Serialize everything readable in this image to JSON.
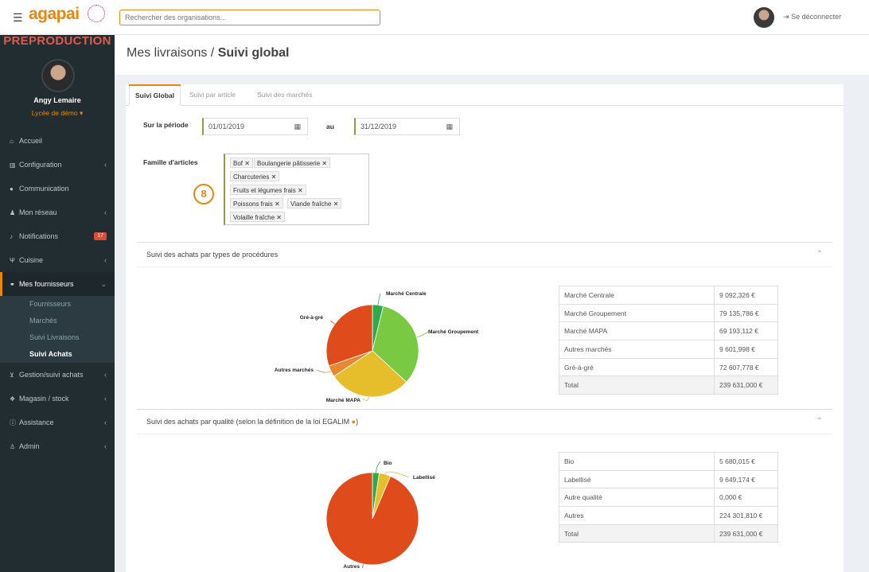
{
  "topbar": {
    "logo": "agapai",
    "search_placeholder": "Rechercher des organisations...",
    "logout": "Se déconnecter"
  },
  "sidebar": {
    "env_label": "PREPRODUCTION",
    "user_name": "Angy Lemaire",
    "user_school": "Lycée de démo ▾",
    "items": [
      {
        "label": "Accueil",
        "icon": "home-icon"
      },
      {
        "label": "Configuration",
        "icon": "bank-icon"
      },
      {
        "label": "Communication",
        "icon": "comments-icon"
      },
      {
        "label": "Mon réseau",
        "icon": "users-icon"
      },
      {
        "label": "Notifications",
        "icon": "bell-icon",
        "badge": "17"
      },
      {
        "label": "Cuisine",
        "icon": "cutlery-icon"
      },
      {
        "label": "Mes fournisseurs",
        "icon": "handshake-icon"
      },
      {
        "label": "Gestion/suivi achats",
        "icon": "cart-icon"
      },
      {
        "label": "Magasin / stock",
        "icon": "cubes-icon"
      },
      {
        "label": "Assistance",
        "icon": "info-icon"
      },
      {
        "label": "Admin",
        "icon": "user-plus-icon"
      }
    ],
    "subitems": [
      "Fournisseurs",
      "Marchés",
      "Suivi Livraisons",
      "Suivi Achats"
    ]
  },
  "header": {
    "title_prefix": "Mes livraisons / ",
    "title_bold": "Suivi global"
  },
  "tabs": [
    "Suivi Global",
    "Suivi par article",
    "Suivi des marchés"
  ],
  "filters": {
    "period_label": "Sur la période",
    "date_from": "01/01/2019",
    "to_label": "au",
    "date_to": "31/12/2019",
    "family_label": "Famille d'articles",
    "tags": [
      "Bof",
      "Boulangerie pâtisserie",
      "Charcuteries",
      "Fruits et légumes frais",
      "Poissons frais",
      "Viande fraîche",
      "Volaille fraîche"
    ],
    "step_number": "8"
  },
  "section1": {
    "title": "Suivi des achats par types de procédures",
    "rows": [
      {
        "label": "Marché Centrale",
        "value": "9 092,326 €"
      },
      {
        "label": "Marché Groupement",
        "value": "79 135,786 €"
      },
      {
        "label": "Marché MAPA",
        "value": "69 193,112 €"
      },
      {
        "label": "Autres marchés",
        "value": "9 601,998 €"
      },
      {
        "label": "Gré-à-gré",
        "value": "72 607,778 €"
      },
      {
        "label": "Total",
        "value": "239 631,000 €"
      }
    ]
  },
  "section2": {
    "title": "Suivi des achats par qualité (selon la définition de la loi EGALIM",
    "title_tail": ")",
    "rows": [
      {
        "label": "Bio",
        "value": "5 680,015 €"
      },
      {
        "label": "Labellisé",
        "value": "9 649,174 €"
      },
      {
        "label": "Autre qualité",
        "value": "0,000 €"
      },
      {
        "label": "Autres",
        "value": "224 301,810 €"
      },
      {
        "label": "Total",
        "value": "239 631,000 €"
      }
    ]
  },
  "chart_data": [
    {
      "type": "pie",
      "categories": [
        "Marché Centrale",
        "Marché Groupement",
        "Marché MAPA",
        "Autres marchés",
        "Gré-à-gré"
      ],
      "values": [
        9092.326,
        79135.786,
        69193.112,
        9601.998,
        72607.778
      ],
      "colors": [
        "#2eaa4c",
        "#7ac943",
        "#e6be2c",
        "#e8872f",
        "#e04b1c"
      ]
    },
    {
      "type": "pie",
      "categories": [
        "Bio",
        "Labellisé",
        "Autre qualité",
        "Autres"
      ],
      "values": [
        5680.015,
        9649.174,
        0,
        224301.81
      ],
      "colors": [
        "#2eaa4c",
        "#e6be2c",
        "#7ac943",
        "#e04b1c"
      ]
    }
  ]
}
